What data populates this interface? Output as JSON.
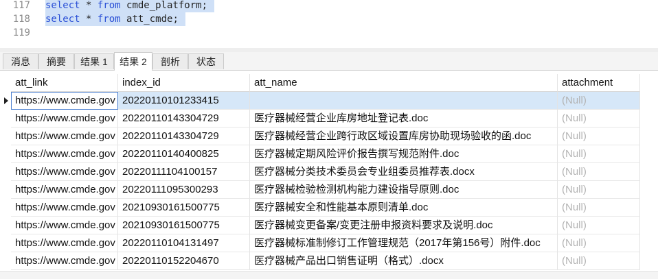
{
  "editor": {
    "lines": [
      {
        "num": "117",
        "kw1": "select",
        "mid": " * ",
        "kw2": "from",
        "rest": " cmde_platform;"
      },
      {
        "num": "118",
        "kw1": "select",
        "mid": " * ",
        "kw2": "from",
        "rest": " att_cmde;"
      },
      {
        "num": "119"
      }
    ]
  },
  "tabs": [
    "消息",
    "摘要",
    "结果 1",
    "结果 2",
    "剖析",
    "状态"
  ],
  "active_tab": "结果 2",
  "grid": {
    "columns": [
      "att_link",
      "index_id",
      "att_name",
      "attachment"
    ],
    "rows": [
      {
        "att_link": "https://www.cmde.gov",
        "index_id": "20220110101233415",
        "att_name": "",
        "attachment": "(Null)"
      },
      {
        "att_link": "https://www.cmde.gov",
        "index_id": "20220110143304729",
        "att_name": "医疗器械经营企业库房地址登记表.doc",
        "attachment": "(Null)"
      },
      {
        "att_link": "https://www.cmde.gov",
        "index_id": "20220110143304729",
        "att_name": "医疗器械经营企业跨行政区域设置库房协助现场验收的函.doc",
        "attachment": "(Null)"
      },
      {
        "att_link": "https://www.cmde.gov",
        "index_id": "20220110140400825",
        "att_name": "医疗器械定期风险评价报告撰写规范附件.doc",
        "attachment": "(Null)"
      },
      {
        "att_link": "https://www.cmde.gov",
        "index_id": "20220111104100157",
        "att_name": "医疗器械分类技术委员会专业组委员推荐表.docx",
        "attachment": "(Null)"
      },
      {
        "att_link": "https://www.cmde.gov",
        "index_id": "20220111095300293",
        "att_name": "医疗器械检验检测机构能力建设指导原则.doc",
        "attachment": "(Null)"
      },
      {
        "att_link": "https://www.cmde.gov",
        "index_id": "20210930161500775",
        "att_name": "医疗器械安全和性能基本原则清单.doc",
        "attachment": "(Null)"
      },
      {
        "att_link": "https://www.cmde.gov",
        "index_id": "20210930161500775",
        "att_name": "医疗器械变更备案/变更注册申报资料要求及说明.doc",
        "attachment": "(Null)"
      },
      {
        "att_link": "https://www.cmde.gov",
        "index_id": "20220110104131497",
        "att_name": "医疗器械标准制修订工作管理规范（2017年第156号）附件.doc",
        "attachment": "(Null)"
      },
      {
        "att_link": "https://www.cmde.gov",
        "index_id": "20220110152204670",
        "att_name": "医疗器械产品出口销售证明（格式）.docx",
        "attachment": "(Null)"
      }
    ]
  }
}
